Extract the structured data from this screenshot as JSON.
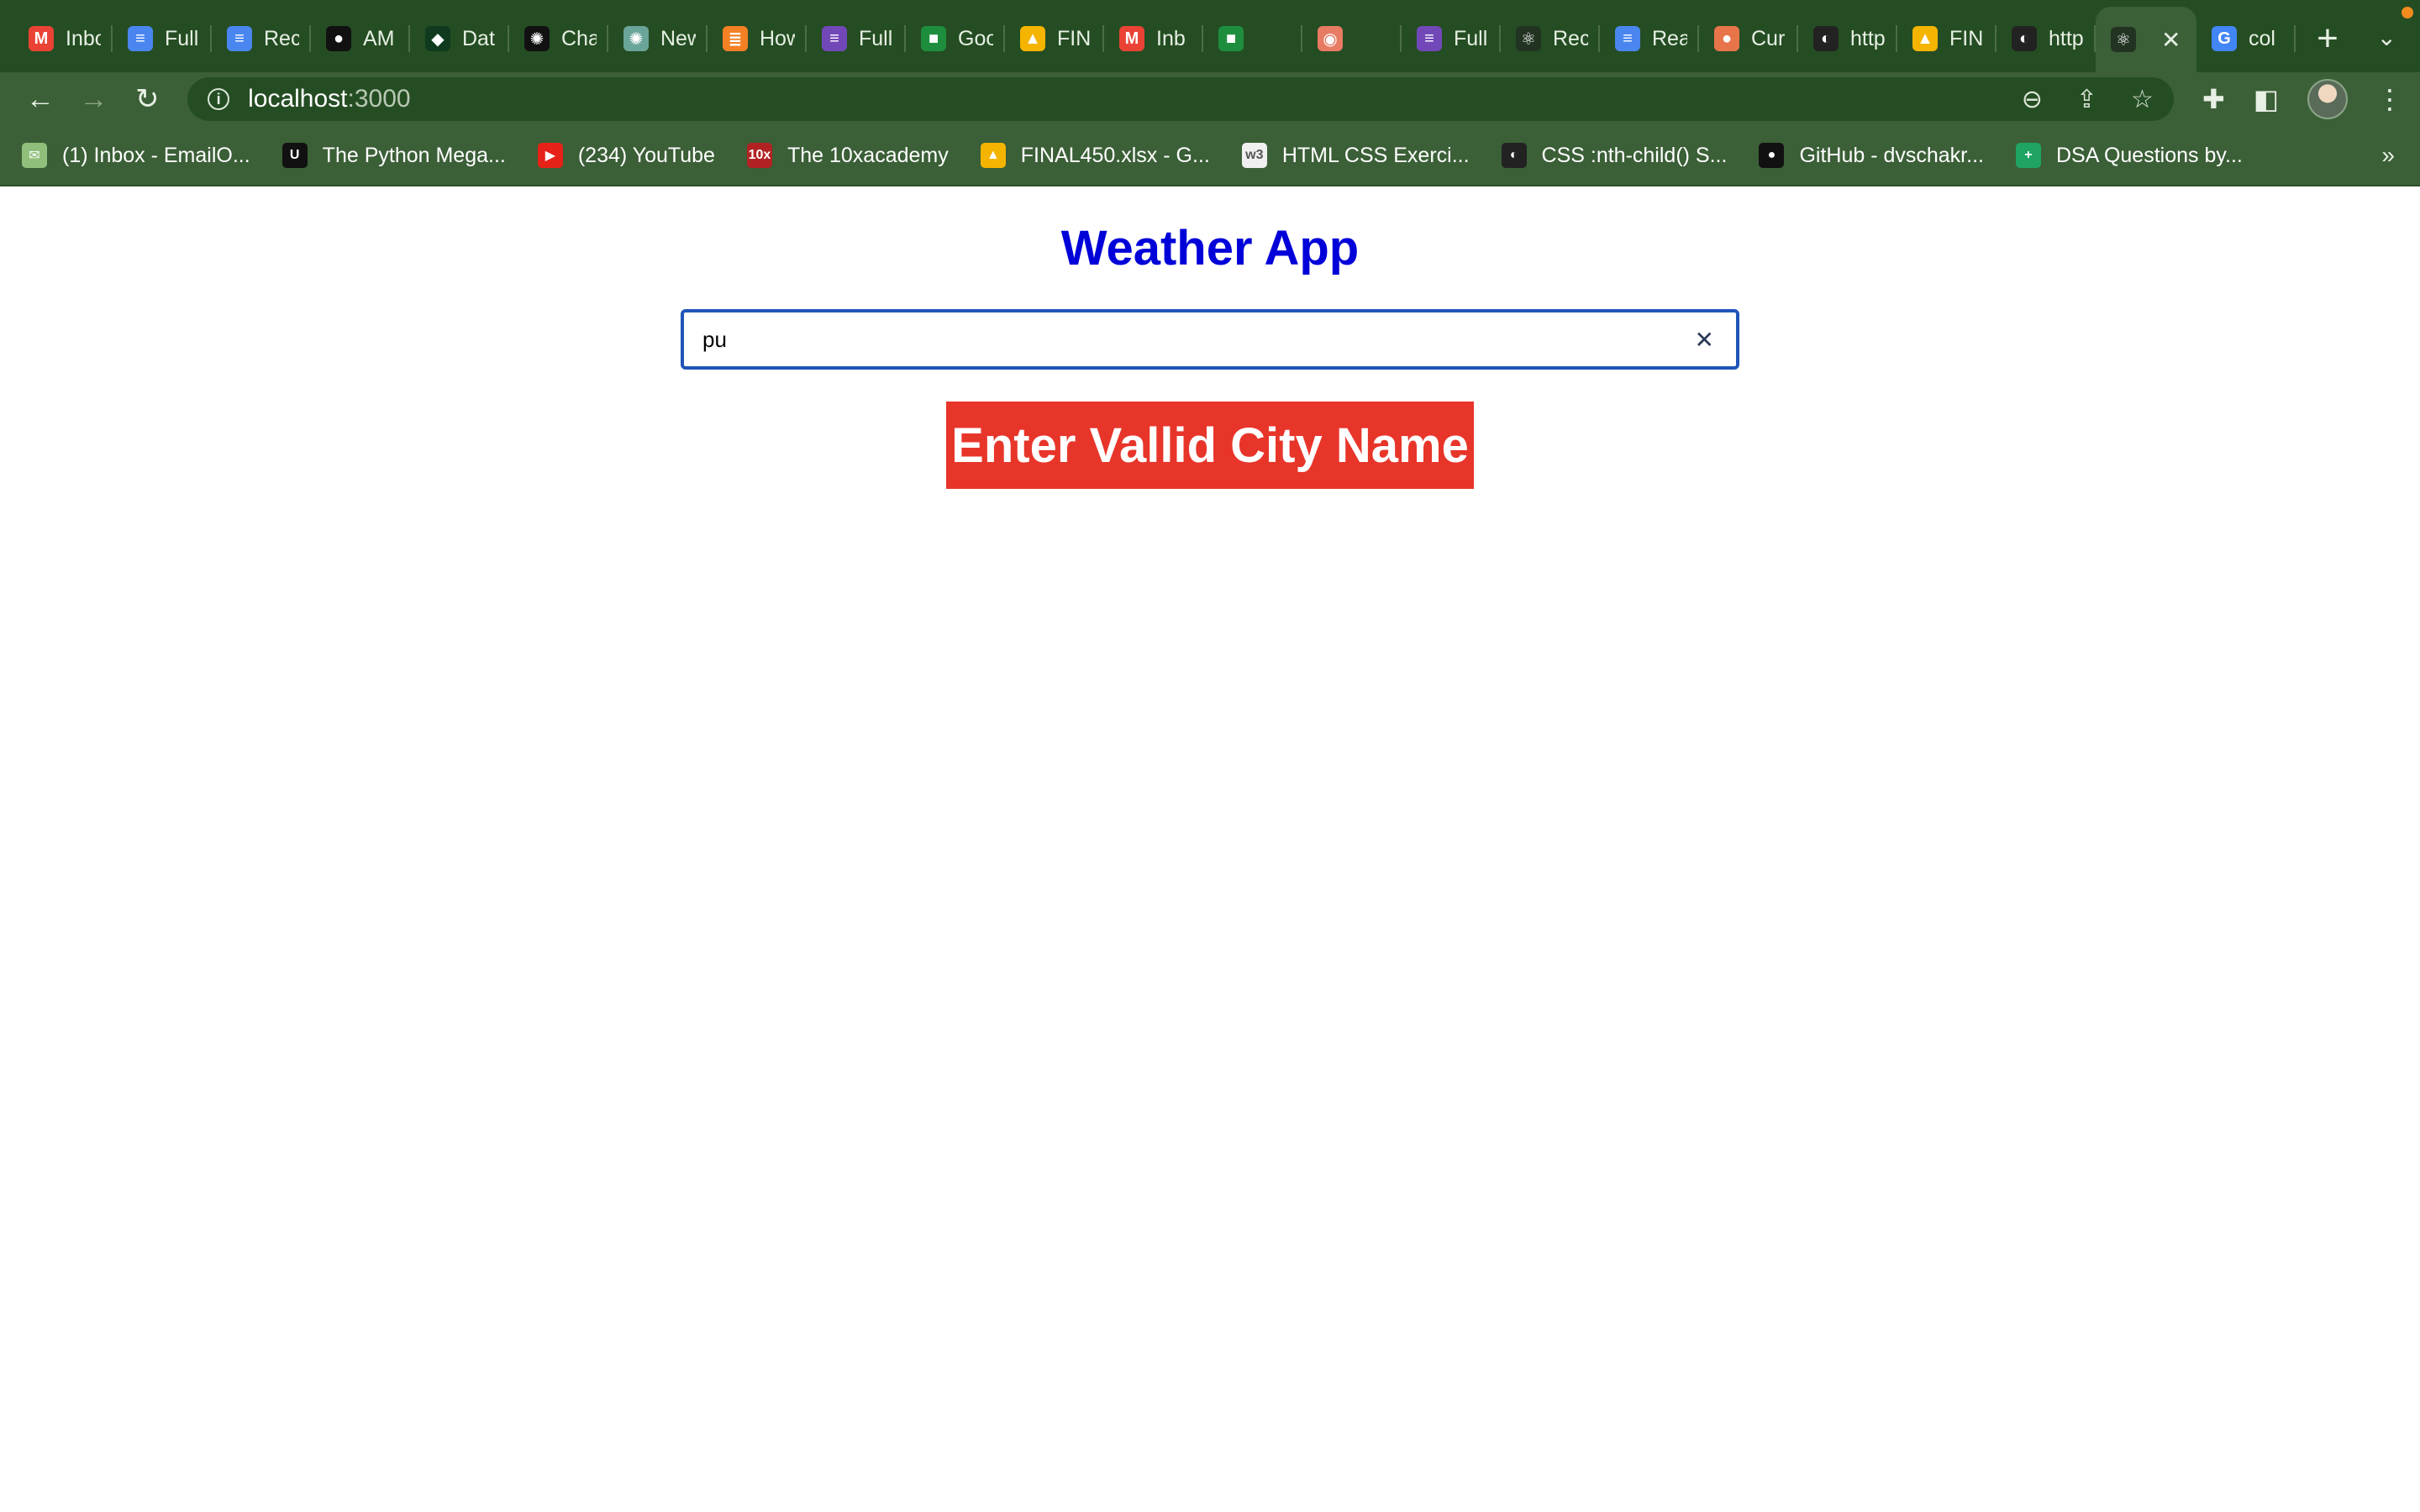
{
  "browser": {
    "tabs": [
      {
        "title": "Inbox",
        "icon": "gmail-icon",
        "color": "#ea4335",
        "glyph": "M"
      },
      {
        "title": "Full",
        "icon": "docs-icon",
        "color": "#4a86f0",
        "glyph": "≡"
      },
      {
        "title": "Rec",
        "icon": "docs-icon",
        "color": "#4a86f0",
        "glyph": "≡"
      },
      {
        "title": "AM",
        "icon": "github-icon",
        "color": "#111111",
        "glyph": "●"
      },
      {
        "title": "Dat",
        "icon": "mongodb-icon",
        "color": "#0f3a1e",
        "glyph": "◆"
      },
      {
        "title": "Cha",
        "icon": "openai-icon",
        "color": "#111111",
        "glyph": "✺"
      },
      {
        "title": "New",
        "icon": "openai-icon",
        "color": "#6aa59a",
        "glyph": "✺"
      },
      {
        "title": "How",
        "icon": "stackoverflow-icon",
        "color": "#f48024",
        "glyph": "≣"
      },
      {
        "title": "Full",
        "icon": "forms-icon",
        "color": "#7248b9",
        "glyph": "≡"
      },
      {
        "title": "Goo",
        "icon": "meet-icon",
        "color": "#1e8e3e",
        "glyph": "■"
      },
      {
        "title": "FIN",
        "icon": "drive-icon",
        "color": "#f5b400",
        "glyph": "▲"
      },
      {
        "title": "Inb",
        "icon": "gmail-icon",
        "color": "#ea4335",
        "glyph": "M"
      },
      {
        "title": "",
        "icon": "meet-icon",
        "color": "#1e8e3e",
        "glyph": "■"
      },
      {
        "title": "",
        "icon": "record-icon",
        "color": "#e87b63",
        "glyph": "◉"
      },
      {
        "title": "Full",
        "icon": "forms-icon",
        "color": "#7248b9",
        "glyph": "≡"
      },
      {
        "title": "Rec",
        "icon": "react-icon",
        "color": "#223322",
        "glyph": "⚛"
      },
      {
        "title": "Rea",
        "icon": "docs-icon",
        "color": "#4a86f0",
        "glyph": "≡"
      },
      {
        "title": "Cur",
        "icon": "cloud-icon",
        "color": "#e8754a",
        "glyph": "●"
      },
      {
        "title": "http",
        "icon": "globe-icon",
        "color": "#222222",
        "glyph": "◐"
      },
      {
        "title": "FIN",
        "icon": "drive-icon",
        "color": "#f5b400",
        "glyph": "▲"
      },
      {
        "title": "http",
        "icon": "globe-icon",
        "color": "#222222",
        "glyph": "◐"
      }
    ],
    "active_tab": {
      "title": "",
      "icon": "react-icon",
      "color": "#223322",
      "glyph": "⚛",
      "close": "✕"
    },
    "last_tab": {
      "title": "col",
      "icon": "google-icon",
      "color": "#4285f4",
      "glyph": "G"
    },
    "new_tab": "+",
    "tab_search": "⌄",
    "address": {
      "host": "localhost",
      "port": ":3000"
    },
    "bookmarks": [
      {
        "label": "(1) Inbox - EmailO...",
        "icon": "mail-icon",
        "color": "#8fbf7a",
        "glyph": "✉"
      },
      {
        "label": "The Python Mega...",
        "icon": "udemy-icon",
        "color": "#111111",
        "glyph": "U"
      },
      {
        "label": "(234) YouTube",
        "icon": "youtube-icon",
        "color": "#e62117",
        "glyph": "▶"
      },
      {
        "label": "The 10xacademy",
        "icon": "academy-icon",
        "color": "#b22222",
        "glyph": "10x"
      },
      {
        "label": "FINAL450.xlsx - G...",
        "icon": "drive-icon",
        "color": "#f5b400",
        "glyph": "▲"
      },
      {
        "label": "HTML CSS Exerci...",
        "icon": "w3schools-icon",
        "color": "#f0f0f0",
        "glyph": "w3"
      },
      {
        "label": "CSS :nth-child() S...",
        "icon": "globe-icon",
        "color": "#222222",
        "glyph": "◐"
      },
      {
        "label": "GitHub - dvschakr...",
        "icon": "github-icon",
        "color": "#111111",
        "glyph": "●"
      },
      {
        "label": "DSA Questions by...",
        "icon": "sheets-icon",
        "color": "#1fa463",
        "glyph": "+"
      }
    ],
    "bookmarks_more": "»"
  },
  "app": {
    "title": "Weather App",
    "search_value": "pu",
    "clear_label": "✕",
    "error_message": "Enter Vallid City Name"
  },
  "colors": {
    "title": "#0000d8",
    "error_bg": "#e8352a",
    "input_border": "#1f55b8",
    "chrome_dark": "#254d23",
    "chrome_light": "#3b5f37"
  }
}
